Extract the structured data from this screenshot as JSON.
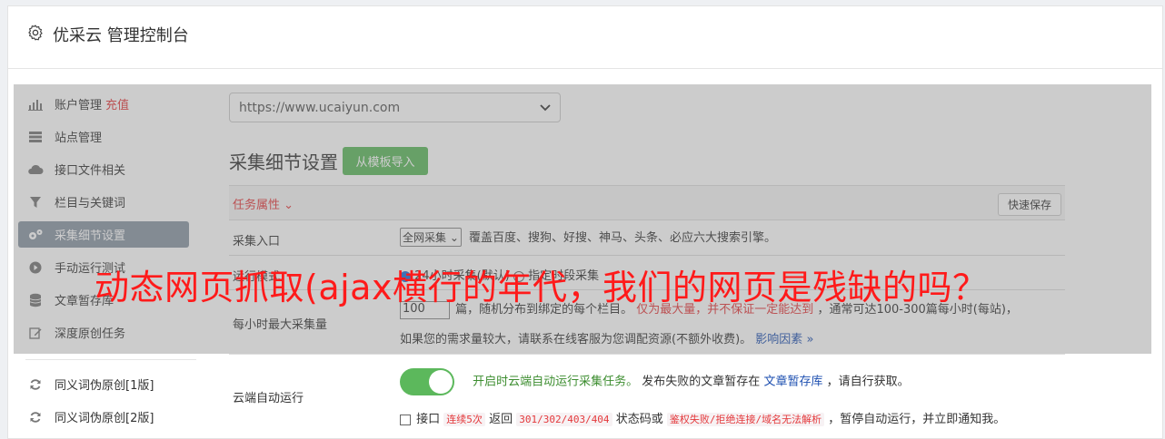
{
  "header": {
    "title": "优采云 管理控制台"
  },
  "sidebar": {
    "items": [
      {
        "label": "账户管理",
        "badge": "充值",
        "icon": "bar-chart-icon"
      },
      {
        "label": "站点管理",
        "icon": "server-icon"
      },
      {
        "label": "接口文件相关",
        "icon": "cloud-icon"
      },
      {
        "label": "栏目与关键词",
        "icon": "filter-icon"
      },
      {
        "label": "采集细节设置",
        "icon": "gears-icon"
      },
      {
        "label": "手动运行测试",
        "icon": "play-icon"
      },
      {
        "label": "文章暂存库",
        "icon": "database-icon"
      },
      {
        "label": "深度原创任务",
        "icon": "edit-icon"
      },
      {
        "label": "同义词伪原创[1版]",
        "icon": "refresh-icon"
      },
      {
        "label": "同义词伪原创[2版]",
        "icon": "refresh-icon"
      }
    ]
  },
  "main": {
    "site_select": "https://www.ucaiyun.com",
    "section_title": "采集细节设置",
    "import_button": "从模板导入",
    "task_attr": "任务属性",
    "task_attr_arrow": "⌄",
    "quick_save": "快速保存",
    "entry": {
      "label": "采集入口",
      "select": "全网采集",
      "desc": "覆盖百度、搜狗、好搜、神马、头条、必应六大搜索引擎。"
    },
    "mode": {
      "label": "运行模式",
      "option1": "24小时采集(默认)",
      "option2": "指定时段采集"
    },
    "max": {
      "label": "每小时最大采集量",
      "value": "100",
      "text1": "篇，随机分布到绑定的每个栏目。",
      "warn": "仅为最大量，并不保证一定能达到",
      "text2": "，通常可达100-300篇每小时(每站)，",
      "text3": "如果您的需求量较大，请联系在线客服为您调配资源(不额外收费)。",
      "link": "影响因素",
      "link_arrow": "»"
    },
    "cloud": {
      "label": "云端自动运行",
      "on_text": "开启时云端自动运行采集任务。",
      "text1": "发布失败的文章暂存在",
      "link": "文章暂存库",
      "text2": "，请自行获取。",
      "check_text": "接口",
      "code1": "连续5次",
      "text3": "返回",
      "code2": "301/302/403/404",
      "text4": "状态码或",
      "code3": "鉴权失败/拒绝连接/域名无法解析",
      "text5": "，暂停自动运行，并立即通知我。"
    }
  },
  "banner": {
    "text": "动态网页抓取(ajax横行的年代，我们的网页是残缺的吗？"
  },
  "colors": {
    "accent_green": "#5cb85c",
    "red": "#e4393c",
    "banner_red": "#ff1a1a",
    "active_nav": "#8a96a4"
  }
}
